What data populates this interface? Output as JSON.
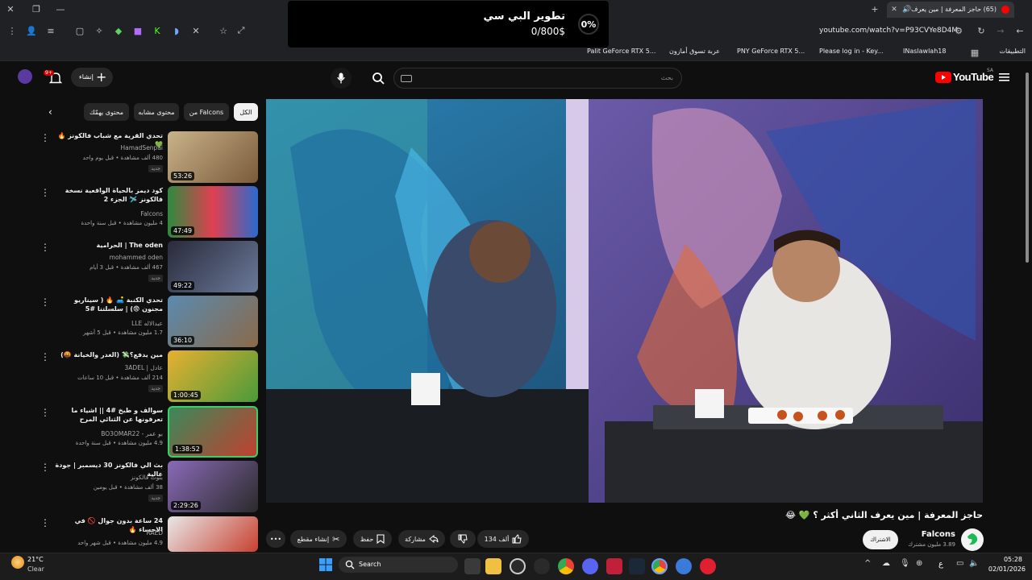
{
  "browser": {
    "tab_title": "(65) حاجز المعرفة | مين يعرف...",
    "address": "youtube.com/watch?v=P93CVYe8D4M",
    "bookmarks": [
      "التطبيقات",
      "INaslawlah18",
      "Please log in - Key...",
      "PNY GeForce RTX 5...",
      "عربة تسوق أمازون",
      "Palit GeForce RTX 5..."
    ]
  },
  "popup": {
    "percent": "0%",
    "title": "تطوير البي سي",
    "amount": "0/800$"
  },
  "yt": {
    "logo_text": "YouTube",
    "logo_sup": "SA",
    "search_placeholder": "بحث",
    "create_label": "إنشاء",
    "notif_count": "9+"
  },
  "chips": [
    "الكل",
    "من Falcons",
    "محتوى مشابه",
    "محتوى يهمّك"
  ],
  "related": [
    {
      "title": "تحدي القرية مع شباب فالكونز 🔥 💚",
      "channel": "HamadSenpai",
      "meta": "480 ألف مشاهدة • قبل يوم واحد",
      "badge": "جديد",
      "duration": "53:26"
    },
    {
      "title": "كود ديمز بالحياة الواقعية نسخة فالكونز 🛩️ الجزء 2",
      "channel": "Falcons",
      "meta": "4 مليون مشاهدة • قبل سنة واحدة",
      "badge": "",
      "duration": "47:49"
    },
    {
      "title": "The oden | الحرامية",
      "channel": "mohammed oden",
      "meta": "467 ألف مشاهدة • قبل 3 أيام",
      "badge": "جديد",
      "duration": "49:22"
    },
    {
      "title": "تحدي الكنبة 🛋️ 🔥 ( سيناريو مجنون 😨) | سلسلتنا #5",
      "channel": "عبدالاله LLE",
      "meta": "1.7 مليون مشاهدة • قبل 5 أشهر",
      "badge": "",
      "duration": "36:10"
    },
    {
      "title": "مين يدفع؟💸 (الغدر والخيانة 🤬)",
      "channel": "عادل | 3ADEL",
      "meta": "214 ألف مشاهدة • قبل 10 ساعات",
      "badge": "جديد",
      "duration": "1:00:45"
    },
    {
      "title": "سوالف و طبخ #4 || اشياء ما تعرفونها عن الثنائي المرح",
      "channel": "بو عمر - BO3OMAR22",
      "meta": "4.9 مليون مشاهدة • قبل سنة واحدة",
      "badge": "",
      "duration": "1:38:52"
    },
    {
      "title": "بث الي فالكونز 30 ديسمبر | جودة عالية",
      "channel": "بثوث فالكونز",
      "meta": "38 ألف مشاهدة • قبل يومين",
      "badge": "جديد",
      "duration": "2:29:26"
    },
    {
      "title": "24 ساعة بدون جوال 🚫 في الاحساء 🔥",
      "channel": "RAED",
      "meta": "4.9 مليون مشاهدة • قبل شهر واحد",
      "badge": "",
      "duration": ""
    }
  ],
  "video": {
    "title": "حاجز المعرفة | مين يعرف الثاني أكثر ؟ 💚 😂",
    "channel": "Falcons",
    "subs": "3.89 مليون مشترك",
    "join_label": "الاشتراك",
    "like_count": "134 ألف",
    "share_label": "مشاركة",
    "save_label": "حفظ",
    "clip_label": "إنشاء مقطع"
  },
  "taskbar": {
    "weather_temp": "21°C",
    "weather_desc": "Clear",
    "search_label": "Search",
    "time": "05:28",
    "date": "02/01/2026",
    "lang": "ع"
  }
}
